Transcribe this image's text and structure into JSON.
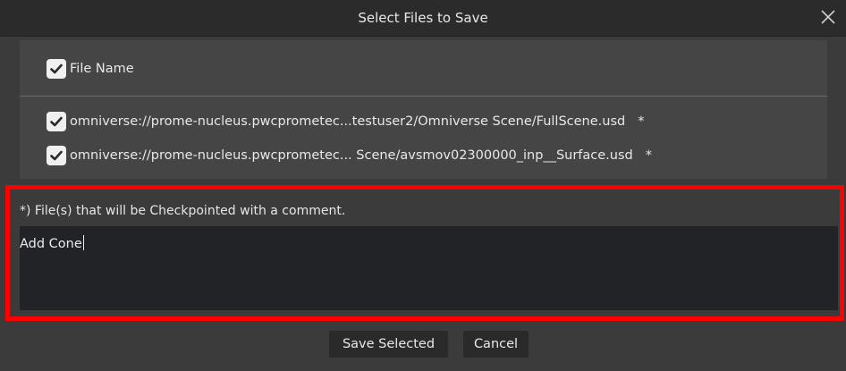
{
  "dialog": {
    "title": "Select Files to Save",
    "close_icon": "close-icon"
  },
  "file_list": {
    "header": {
      "checked": true,
      "label": "File Name"
    },
    "files": [
      {
        "checked": true,
        "path": "omniverse://prome-nucleus.pwcprometec...testuser2/Omniverse Scene/FullScene.usd",
        "marker": "*"
      },
      {
        "checked": true,
        "path": "omniverse://prome-nucleus.pwcprometec... Scene/avsmov02300000_inp__Surface.usd",
        "marker": "*"
      }
    ]
  },
  "comment": {
    "note": "*) File(s) that will be Checkpointed with a comment.",
    "value": "Add Cone"
  },
  "buttons": {
    "save_selected": "Save Selected",
    "cancel": "Cancel"
  },
  "colors": {
    "highlight": "#ff0000",
    "titlebar": "#2b2b2b",
    "panel": "#454545",
    "input": "#222326"
  }
}
